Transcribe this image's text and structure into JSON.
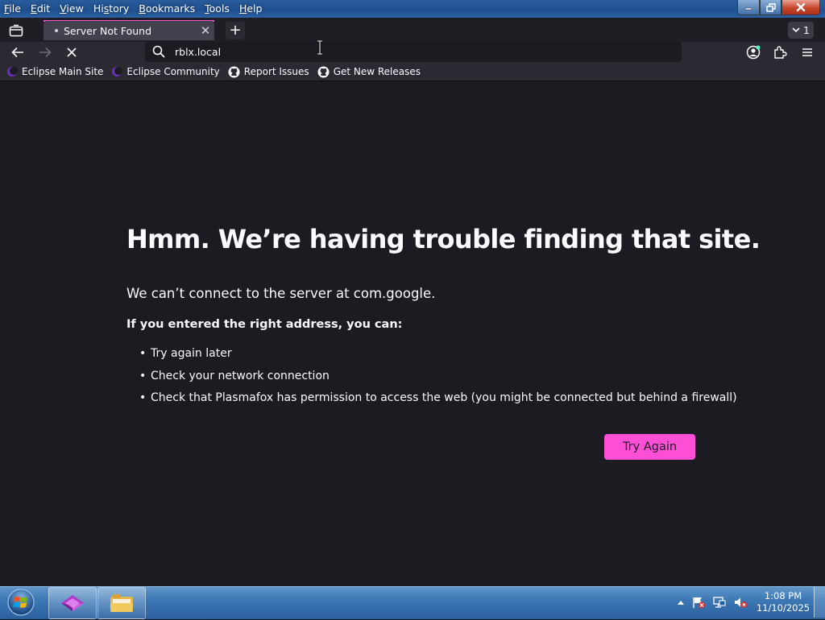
{
  "menu": {
    "items": [
      {
        "accel": "F",
        "rest": "ile"
      },
      {
        "accel": "E",
        "rest": "dit"
      },
      {
        "accel": "V",
        "rest": "iew"
      },
      {
        "accel": "",
        "rest": "Hi",
        "accel2": "s",
        "rest2": "tory"
      },
      {
        "accel": "B",
        "rest": "ookmarks"
      },
      {
        "accel": "T",
        "rest": "ools"
      },
      {
        "accel": "H",
        "rest": "elp"
      }
    ]
  },
  "tab": {
    "title": "Server Not Found",
    "close": "✕",
    "new": "+"
  },
  "tab_overflow": {
    "count": "1"
  },
  "urlbar": {
    "value": "rblx.local"
  },
  "bookmarks": [
    {
      "label": "Eclipse Main Site",
      "icon": "eclipse-icon"
    },
    {
      "label": "Eclipse Community",
      "icon": "eclipse-icon"
    },
    {
      "label": "Report Issues",
      "icon": "github-icon"
    },
    {
      "label": "Get New Releases",
      "icon": "github-icon"
    }
  ],
  "error": {
    "title": "Hmm. We’re having trouble finding that site.",
    "intro": "We can’t connect to the server at com.google.",
    "sub": "If you entered the right address, you can:",
    "items": [
      "Try again later",
      "Check your network connection",
      "Check that Plasmafox has permission to access the web (you might be connected but behind a firewall)"
    ],
    "button": "Try Again"
  },
  "clock": {
    "time": "1:08 PM",
    "date": "11/10/2025"
  },
  "colors": {
    "accent": "#ff4fd6",
    "page_bg": "#1c1b22",
    "toolbar_bg": "#2b2a33"
  }
}
